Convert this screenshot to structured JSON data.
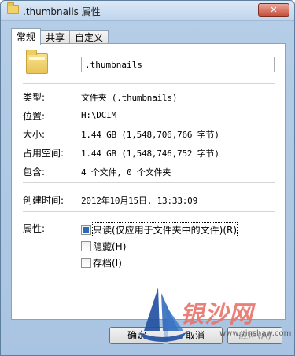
{
  "window": {
    "title": ".thumbnails 属性",
    "close_label": "✕"
  },
  "tabs": [
    {
      "label": "常规",
      "active": true
    },
    {
      "label": "共享",
      "active": false
    },
    {
      "label": "自定义",
      "active": false
    }
  ],
  "general": {
    "name_value": ".thumbnails",
    "rows": {
      "type": {
        "label": "类型:",
        "value": "文件夹 (.thumbnails)"
      },
      "location": {
        "label": "位置:",
        "value": "H:\\DCIM"
      },
      "size": {
        "label": "大小:",
        "value": "1.44 GB (1,548,706,766 字节)"
      },
      "size_on_disk": {
        "label": "占用空间:",
        "value": "1.44 GB (1,548,746,752 字节)"
      },
      "contains": {
        "label": "包含:",
        "value": "4 个文件, 0 个文件夹"
      },
      "created": {
        "label": "创建时间:",
        "value": "2012年10月15日, 13:33:09"
      },
      "attributes": {
        "label": "属性:"
      }
    },
    "attributes": [
      {
        "label": "只读(仅应用于文件夹中的文件)(R)",
        "state": "mixed"
      },
      {
        "label": "隐藏(H)",
        "state": "unchecked"
      },
      {
        "label": "存档(I)",
        "state": "unchecked"
      }
    ]
  },
  "buttons": {
    "ok": "确定",
    "cancel": "取消",
    "apply": "应用(A)"
  },
  "watermark": {
    "text": "银沙网",
    "url": "www.yinshaw.com"
  },
  "colors": {
    "accent": "#2b6bb7",
    "watermark": "#e8736a"
  }
}
